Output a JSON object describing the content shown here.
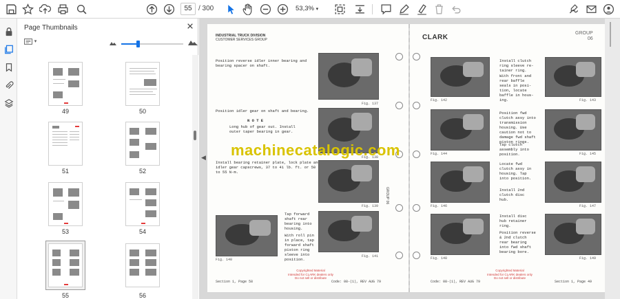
{
  "toolbar": {
    "page_current": "55",
    "page_total": "/ 300",
    "zoom": "53,3%"
  },
  "thumbnails": {
    "title": "Page Thumbnails",
    "pages": [
      "49",
      "50",
      "51",
      "52",
      "53",
      "54",
      "55",
      "56"
    ],
    "selected_page": "55"
  },
  "document": {
    "watermark": "machinecatalogic.com",
    "left_page": {
      "header": [
        "INDUSTRIAL TRUCK DIVISION",
        "CUSTOMER SERVICES GROUP"
      ],
      "steps": [
        "Position reverse idler inner bearing and\nbearing spacer on shaft.",
        "Position idler gear on shaft and bearing.",
        "N O T E",
        "Long hub of gear out. Install\nouter taper bearing in gear.",
        "Install bearing retainer plate, lock plate and\nidler gear capscrews, 37 to 41 lb. ft. or 50\nto 55 N·m.",
        "Tap forward\nshaft rear\nbearing into\nhousing.",
        "With roll pin\nin place, tap\nforward shaft\npiston ring\nsleeve into\nposition."
      ],
      "figures": [
        "Fig. 137",
        "Fig. 138",
        "Fig. 139",
        "Fig. 140",
        "Fig. 141"
      ],
      "copyright": [
        "Copyrighted Material",
        "Intended for CLARK dealers only",
        "Do not sell or distribute"
      ],
      "footer_left": "Section 1, Page 58",
      "footer_right": "Code: 08-(1), REV AUG 79"
    },
    "right_page": {
      "logo": "CLARK",
      "group": [
        "GROUP",
        "06"
      ],
      "steps": [
        "Install clutch\nring sleeve re-\ntainer ring.",
        "With front and\nrear baffle\nseals in posi-\ntion, locate\nbaffle in hous-\ning.",
        "Position fwd\nclutch assy into\ntransmission\nhousing. Use\ncaution not to\ndamage fwd shaft\npiston rings.",
        "Tap clutch\nassembly into\nposition.",
        "Locate fwd\nclutch assy in\nhousing. Tap\ninto position.",
        "Install 2nd\nclutch disc\nhub.",
        "Install disc\nhub retainer\nring.",
        "Position reverse\n& 2nd clutch\nrear bearing\ninto fwd shaft\nbearing bore."
      ],
      "figures": [
        "Fig. 142",
        "Fig. 143",
        "Fig. 144",
        "Fig. 145",
        "Fig. 146",
        "Fig. 147",
        "Fig. 148",
        "Fig. 149"
      ],
      "copyright": [
        "Copyrighted Material",
        "Intended for CLARK dealers only",
        "Do not sell or distribute"
      ],
      "footer_left": "Code: 08-(1), REV AUG 79",
      "footer_right": "Section 1, Page 49",
      "side_group": "GROUP 06"
    }
  },
  "colors": {
    "accent": "#1473e6",
    "watermark": "#d9c300",
    "copyright": "#d23a3a"
  },
  "icons": {
    "toolbar": [
      "save-icon",
      "bookmark-star-icon",
      "upload-icon",
      "print-icon",
      "zoom-search-icon",
      "prev-page-icon",
      "next-page-icon",
      "select-cursor-icon",
      "hand-icon",
      "zoom-out-icon",
      "zoom-in-icon",
      "fit-page-icon",
      "scroll-mode-icon",
      "comment-icon",
      "pen-icon",
      "highlight-icon",
      "delete-icon",
      "undo-icon",
      "sign-icon",
      "email-icon",
      "account-icon"
    ],
    "rail": [
      "lock-icon",
      "thumbnails-icon",
      "bookmark-icon",
      "attachment-icon",
      "layers-icon"
    ]
  }
}
